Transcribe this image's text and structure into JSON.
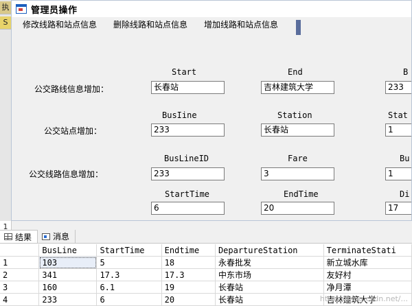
{
  "ide": {
    "tab1": "执",
    "tab2": "S",
    "tab3": "1"
  },
  "window": {
    "title": "管理员操作",
    "menu": [
      "修改线路和站点信息",
      "删除线路和站点信息",
      "增加线路和站点信息"
    ]
  },
  "form": {
    "route_add": {
      "label": "公交路线信息增加：",
      "fields": [
        {
          "header": "Start",
          "value": "长春站"
        },
        {
          "header": "End",
          "value": "吉林建筑大学"
        },
        {
          "header": "B",
          "value": "233"
        }
      ]
    },
    "station_add": {
      "label": "公交站点增加：",
      "fields": [
        {
          "header": "BusIine",
          "value": "233"
        },
        {
          "header": "Station",
          "value": "长春站"
        },
        {
          "header": "Stat",
          "value": "1"
        }
      ]
    },
    "line_info_add": {
      "label": "公交线路信息增加：",
      "fields": [
        {
          "header": "BusLineID",
          "value": "233"
        },
        {
          "header": "Fare",
          "value": "3"
        },
        {
          "header": "Bu",
          "value": "1"
        },
        {
          "header": "StartTime",
          "value": "6"
        },
        {
          "header": "EndTime",
          "value": "20"
        },
        {
          "header": "Di",
          "value": "17"
        }
      ]
    }
  },
  "results": {
    "tabs": [
      "结果",
      "消息"
    ],
    "columns": [
      "",
      "BusLine",
      "StartTime",
      "Endtime",
      "DepartureStation",
      "TerminateStati"
    ],
    "rows": [
      [
        "1",
        "103",
        "5",
        "18",
        "永春批发",
        "新立城水库"
      ],
      [
        "2",
        "341",
        "17.3",
        "17.3",
        "中东市场",
        "友好村"
      ],
      [
        "3",
        "160",
        "6.1",
        "19",
        "长春站",
        "净月潭"
      ],
      [
        "4",
        "233",
        "6",
        "20",
        "长春站",
        "吉林建筑大学"
      ]
    ]
  },
  "watermark": "https://blog.csdn.net/..."
}
